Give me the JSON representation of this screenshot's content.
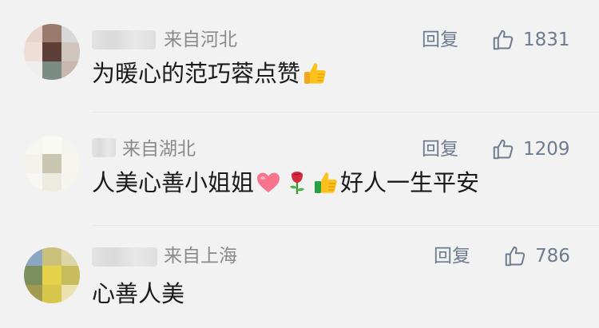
{
  "comments": [
    {
      "location": "来自河北",
      "reply_label": "回复",
      "likes": "1831",
      "text_parts": [
        "为暖心的范巧蓉点赞"
      ],
      "emoji_icons": [
        "thumbs-up-icon"
      ]
    },
    {
      "location": "来自湖北",
      "reply_label": "回复",
      "likes": "1209",
      "text_parts": [
        "人美心善小姐姐",
        "好人一生平安"
      ],
      "emoji_icons": [
        "heart-icon",
        "rose-icon",
        "thumbs-up-icon"
      ]
    },
    {
      "location": "来自上海",
      "reply_label": "回复",
      "likes": "786",
      "text_parts": [
        "心善人美"
      ],
      "emoji_icons": []
    }
  ],
  "colors": {
    "background": "#f2f2f2",
    "secondary_text": "#8a8a8a",
    "action_text": "#6e7b8e",
    "body_text": "#1a1a1a"
  }
}
